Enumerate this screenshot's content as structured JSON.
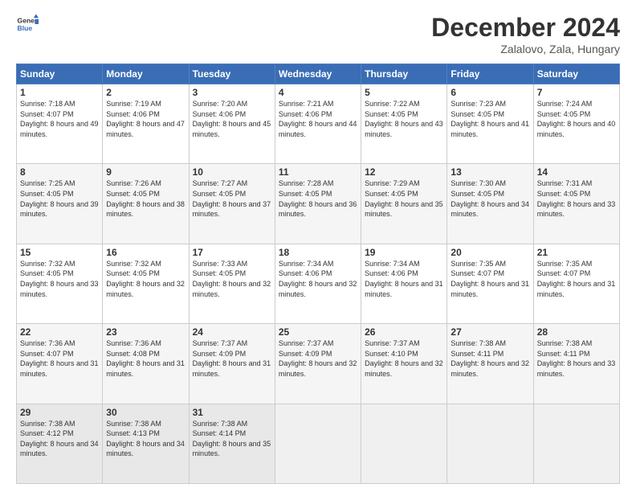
{
  "header": {
    "logo_line1": "General",
    "logo_line2": "Blue",
    "month": "December 2024",
    "location": "Zalalovo, Zala, Hungary"
  },
  "weekdays": [
    "Sunday",
    "Monday",
    "Tuesday",
    "Wednesday",
    "Thursday",
    "Friday",
    "Saturday"
  ],
  "weeks": [
    [
      {
        "day": 1,
        "sunrise": "7:18 AM",
        "sunset": "4:07 PM",
        "daylight": "8 hours and 49 minutes."
      },
      {
        "day": 2,
        "sunrise": "7:19 AM",
        "sunset": "4:06 PM",
        "daylight": "8 hours and 47 minutes."
      },
      {
        "day": 3,
        "sunrise": "7:20 AM",
        "sunset": "4:06 PM",
        "daylight": "8 hours and 45 minutes."
      },
      {
        "day": 4,
        "sunrise": "7:21 AM",
        "sunset": "4:06 PM",
        "daylight": "8 hours and 44 minutes."
      },
      {
        "day": 5,
        "sunrise": "7:22 AM",
        "sunset": "4:05 PM",
        "daylight": "8 hours and 43 minutes."
      },
      {
        "day": 6,
        "sunrise": "7:23 AM",
        "sunset": "4:05 PM",
        "daylight": "8 hours and 41 minutes."
      },
      {
        "day": 7,
        "sunrise": "7:24 AM",
        "sunset": "4:05 PM",
        "daylight": "8 hours and 40 minutes."
      }
    ],
    [
      {
        "day": 8,
        "sunrise": "7:25 AM",
        "sunset": "4:05 PM",
        "daylight": "8 hours and 39 minutes."
      },
      {
        "day": 9,
        "sunrise": "7:26 AM",
        "sunset": "4:05 PM",
        "daylight": "8 hours and 38 minutes."
      },
      {
        "day": 10,
        "sunrise": "7:27 AM",
        "sunset": "4:05 PM",
        "daylight": "8 hours and 37 minutes."
      },
      {
        "day": 11,
        "sunrise": "7:28 AM",
        "sunset": "4:05 PM",
        "daylight": "8 hours and 36 minutes."
      },
      {
        "day": 12,
        "sunrise": "7:29 AM",
        "sunset": "4:05 PM",
        "daylight": "8 hours and 35 minutes."
      },
      {
        "day": 13,
        "sunrise": "7:30 AM",
        "sunset": "4:05 PM",
        "daylight": "8 hours and 34 minutes."
      },
      {
        "day": 14,
        "sunrise": "7:31 AM",
        "sunset": "4:05 PM",
        "daylight": "8 hours and 33 minutes."
      }
    ],
    [
      {
        "day": 15,
        "sunrise": "7:32 AM",
        "sunset": "4:05 PM",
        "daylight": "8 hours and 33 minutes."
      },
      {
        "day": 16,
        "sunrise": "7:32 AM",
        "sunset": "4:05 PM",
        "daylight": "8 hours and 32 minutes."
      },
      {
        "day": 17,
        "sunrise": "7:33 AM",
        "sunset": "4:05 PM",
        "daylight": "8 hours and 32 minutes."
      },
      {
        "day": 18,
        "sunrise": "7:34 AM",
        "sunset": "4:06 PM",
        "daylight": "8 hours and 32 minutes."
      },
      {
        "day": 19,
        "sunrise": "7:34 AM",
        "sunset": "4:06 PM",
        "daylight": "8 hours and 31 minutes."
      },
      {
        "day": 20,
        "sunrise": "7:35 AM",
        "sunset": "4:07 PM",
        "daylight": "8 hours and 31 minutes."
      },
      {
        "day": 21,
        "sunrise": "7:35 AM",
        "sunset": "4:07 PM",
        "daylight": "8 hours and 31 minutes."
      }
    ],
    [
      {
        "day": 22,
        "sunrise": "7:36 AM",
        "sunset": "4:07 PM",
        "daylight": "8 hours and 31 minutes."
      },
      {
        "day": 23,
        "sunrise": "7:36 AM",
        "sunset": "4:08 PM",
        "daylight": "8 hours and 31 minutes."
      },
      {
        "day": 24,
        "sunrise": "7:37 AM",
        "sunset": "4:09 PM",
        "daylight": "8 hours and 31 minutes."
      },
      {
        "day": 25,
        "sunrise": "7:37 AM",
        "sunset": "4:09 PM",
        "daylight": "8 hours and 32 minutes."
      },
      {
        "day": 26,
        "sunrise": "7:37 AM",
        "sunset": "4:10 PM",
        "daylight": "8 hours and 32 minutes."
      },
      {
        "day": 27,
        "sunrise": "7:38 AM",
        "sunset": "4:11 PM",
        "daylight": "8 hours and 32 minutes."
      },
      {
        "day": 28,
        "sunrise": "7:38 AM",
        "sunset": "4:11 PM",
        "daylight": "8 hours and 33 minutes."
      }
    ],
    [
      {
        "day": 29,
        "sunrise": "7:38 AM",
        "sunset": "4:12 PM",
        "daylight": "8 hours and 34 minutes."
      },
      {
        "day": 30,
        "sunrise": "7:38 AM",
        "sunset": "4:13 PM",
        "daylight": "8 hours and 34 minutes."
      },
      {
        "day": 31,
        "sunrise": "7:38 AM",
        "sunset": "4:14 PM",
        "daylight": "8 hours and 35 minutes."
      },
      null,
      null,
      null,
      null
    ]
  ],
  "labels": {
    "sunrise": "Sunrise:",
    "sunset": "Sunset:",
    "daylight": "Daylight hours"
  }
}
